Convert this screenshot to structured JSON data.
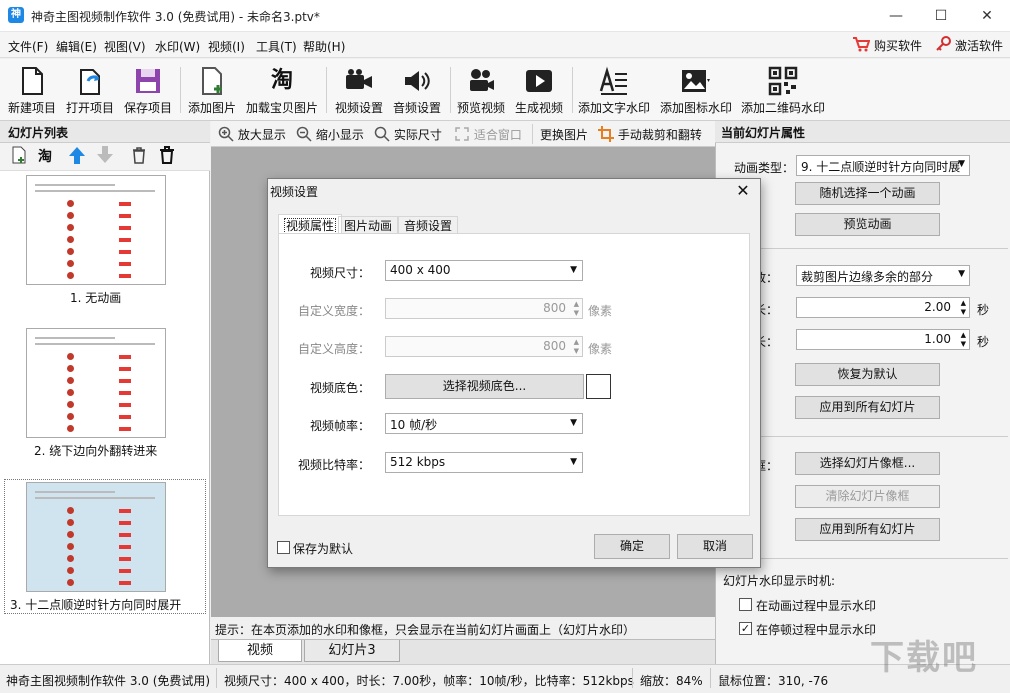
{
  "window": {
    "title": "神奇主图视频制作软件 3.0 (免费试用) - 未命名3.ptv*",
    "app_icon_glyph": "神",
    "minimize_glyph": "—",
    "maximize_glyph": "☐",
    "close_glyph": "✕"
  },
  "menu": {
    "items": [
      "文件(F)",
      "编辑(E)",
      "视图(V)",
      "水印(W)",
      "视频(I)",
      "工具(T)",
      "帮助(H)"
    ],
    "buy": "购买软件",
    "activate": "激活软件"
  },
  "toolbar": {
    "new_project": "新建项目",
    "open_project": "打开项目",
    "save_project": "保存项目",
    "add_image": "添加图片",
    "load_taobao": "加载宝贝图片",
    "taobao_glyph": "淘",
    "video_settings": "视频设置",
    "audio_settings": "音频设置",
    "preview_video": "预览视频",
    "generate_video": "生成视频",
    "add_text_watermark": "添加文字水印",
    "add_icon_watermark": "添加图标水印",
    "add_qr_watermark": "添加二维码水印"
  },
  "left_panel": {
    "header": "幻灯片列表",
    "taobao_glyph": "淘",
    "slides": [
      {
        "label": "1. 无动画"
      },
      {
        "label": "2. 绕下边向外翻转进来"
      },
      {
        "label": "3. 十二点顺逆时针方向同时展开"
      }
    ]
  },
  "center_toolbar": {
    "zoom_in": "放大显示",
    "zoom_out": "缩小显示",
    "actual_size": "实际尺寸",
    "fit_window": "适合窗口",
    "replace_image": "更换图片",
    "crop_flip": "手动裁剪和翻转"
  },
  "hint": "提示：在本页添加的水印和像框，只会显示在当前幻灯片画面上（幻灯片水印）",
  "bottom_tabs": [
    "视频",
    "幻灯片3"
  ],
  "right_panel": {
    "header": "当前幻灯片属性",
    "anim_type_label": "动画类型：",
    "anim_type_value": "9. 十二点顺逆时针方向同时展",
    "random_anim": "随机选择一个动画",
    "preview_anim": "预览动画",
    "scale_label": "缩放：",
    "scale_value": "裁剪图片边缘多余的部分",
    "duration_label": "时长：",
    "duration_value": "2.00",
    "duration_unit": "秒",
    "anim_duration_label": "时长：",
    "anim_duration_value": "1.00",
    "anim_duration_unit": "秒",
    "restore_default": "恢复为默认",
    "apply_all_1": "应用到所有幻灯片",
    "frame_label": "像框：",
    "select_frame": "选择幻灯片像框...",
    "clear_frame": "清除幻灯片像框",
    "apply_all_2": "应用到所有幻灯片",
    "watermark_timing": "幻灯片水印显示时机:",
    "show_during_anim": "在动画过程中显示水印",
    "show_during_pause": "在停顿过程中显示水印",
    "show_during_anim_checked": false,
    "show_during_pause_checked": true
  },
  "status": {
    "app": "神奇主图视频制作软件 3.0 (免费试用)",
    "info": "视频尺寸：400 x 400，时长：7.00秒，帧率：10帧/秒，比特率：512kbps",
    "zoom": "缩放：84%",
    "mouse": "鼠标位置：310, -76"
  },
  "dialog": {
    "title": "视频设置",
    "tabs": [
      "视频属性",
      "图片动画",
      "音频设置"
    ],
    "active_tab": "视频属性",
    "size_label": "视频尺寸：",
    "size_value": "400 x 400",
    "width_label": "自定义宽度：",
    "width_value": "800",
    "height_label": "自定义高度：",
    "height_value": "800",
    "unit": "像素",
    "bg_label": "视频底色：",
    "bg_button": "选择视频底色...",
    "bg_color": "#ffffff",
    "fps_label": "视频帧率：",
    "fps_value": "10 帧/秒",
    "bitrate_label": "视频比特率：",
    "bitrate_value": "512 kbps",
    "save_default": "保存为默认",
    "save_default_checked": false,
    "ok": "确定",
    "cancel": "取消"
  },
  "watermark_text": "下载吧",
  "colors": {
    "accent": "#1e88e5",
    "brand_red": "#e53935"
  }
}
